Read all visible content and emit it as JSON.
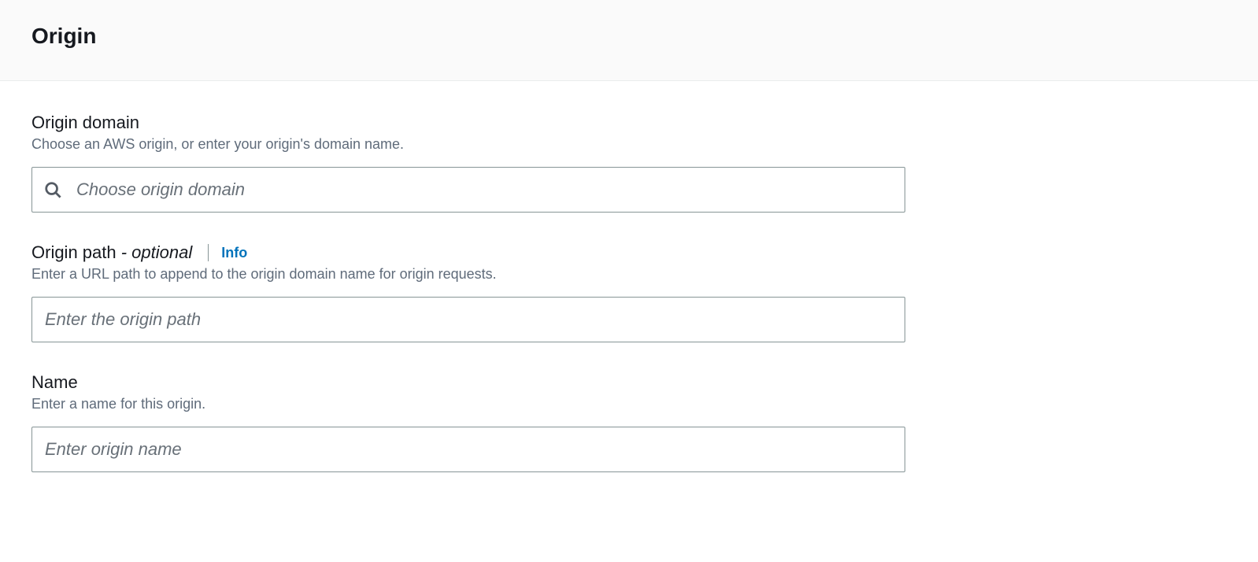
{
  "header": {
    "title": "Origin"
  },
  "fields": {
    "origin_domain": {
      "label": "Origin domain",
      "description": "Choose an AWS origin, or enter your origin's domain name.",
      "placeholder": "Choose origin domain",
      "value": ""
    },
    "origin_path": {
      "label": "Origin path",
      "optional_tag": " - optional",
      "info_label": "Info",
      "description": "Enter a URL path to append to the origin domain name for origin requests.",
      "placeholder": "Enter the origin path",
      "value": ""
    },
    "name": {
      "label": "Name",
      "description": "Enter a name for this origin.",
      "placeholder": "Enter origin name",
      "value": ""
    }
  }
}
